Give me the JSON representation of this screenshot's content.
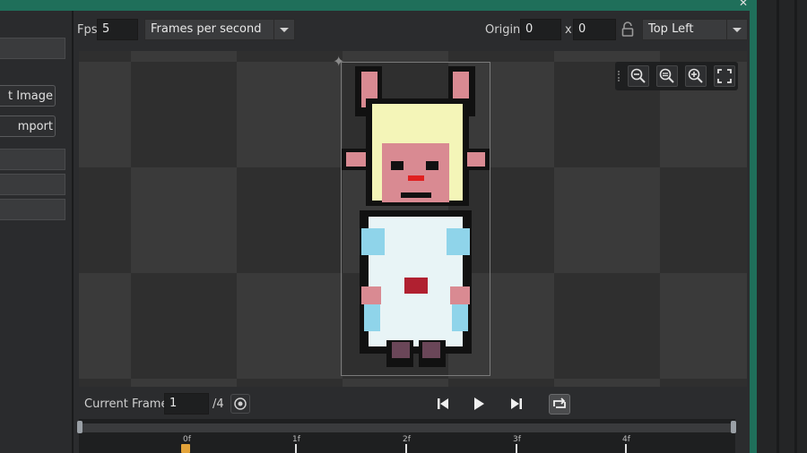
{
  "toolbar": {
    "fps_label": "Fps",
    "fps_value": "5",
    "fps_mode": "Frames per second",
    "origin_label": "Origin",
    "origin_x": "0",
    "origin_sep": "x",
    "origin_y": "0",
    "origin_preset": "Top Left"
  },
  "left_panel": {
    "button_1": "t Image",
    "button_2": "mport"
  },
  "playback": {
    "current_frame_label": "Current Frame:",
    "current_frame_value": "1",
    "total_frames": "/4"
  },
  "timeline": {
    "markers": [
      "0f",
      "1f",
      "2f",
      "3f",
      "4f"
    ]
  },
  "icons": {
    "zoom_out": "zoom-out-icon",
    "zoom_reset": "zoom-reset-icon",
    "zoom_in": "zoom-in-icon",
    "fullscreen": "fullscreen-icon",
    "lock": "lock-icon",
    "origin_crosshair": "crosshair-icon",
    "onion": "onion-skin-icon",
    "first": "skip-to-start-icon",
    "play": "play-icon",
    "last": "skip-to-end-icon",
    "loop": "loop-icon"
  },
  "colors": {
    "accent": "#1f6f5a",
    "playhead": "#e3a33a"
  }
}
